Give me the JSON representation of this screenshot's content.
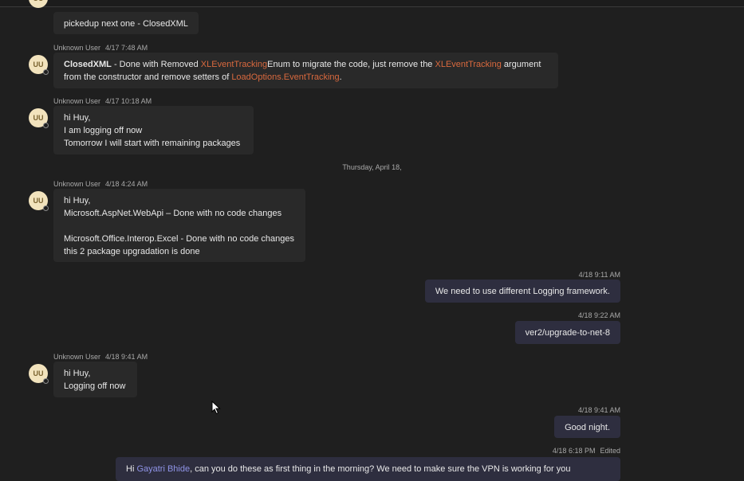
{
  "avatar_initials": "UU",
  "date_separator": "Thursday, April 18,",
  "messages": [
    {
      "text": "pickedup next one - ClosedXML"
    },
    {
      "sender": "Unknown User",
      "time": "4/17 7:48 AM",
      "line1": {
        "bold": "ClosedXML",
        "t1": " - Done with Removed ",
        "o1": "XLEventTracking",
        "t2": "Enum to migrate the code, just remove the ",
        "o2": "XLEventTracking",
        "t3": " argument"
      },
      "line2": {
        "t1": "from the constructor and remove setters of ",
        "o1": "LoadOptions.EventTracking",
        "t2": "."
      }
    },
    {
      "sender": "Unknown User",
      "time": "4/17 10:18 AM",
      "lines": [
        "hi Huy,",
        "I am logging off now",
        "Tomorrow I will start with remaining packages"
      ]
    },
    {
      "sender": "Unknown User",
      "time": "4/18 4:24 AM",
      "lines": [
        "hi Huy,",
        "Microsoft.AspNet.WebApi  – Done with no code changes",
        "",
        "Microsoft.Office.Interop.Excel  -  Done with no code changes",
        "this 2 package upgradation is done"
      ]
    },
    {
      "time": "4/18 9:11 AM",
      "text": "We need to use different Logging framework."
    },
    {
      "time": "4/18 9:22 AM",
      "text": "ver2/upgrade-to-net-8"
    },
    {
      "sender": "Unknown User",
      "time": "4/18 9:41 AM",
      "lines": [
        "hi Huy,",
        "Logging off now"
      ]
    },
    {
      "time": "4/18 9:41 AM",
      "text": "Good night."
    },
    {
      "time": "4/18 6:18 PM",
      "edited": "Edited",
      "greeting": "Hi ",
      "mention": "Gayatri Bhide",
      "text": ", can you do these as first thing in the morning? We need to make sure the VPN is working for you"
    }
  ]
}
